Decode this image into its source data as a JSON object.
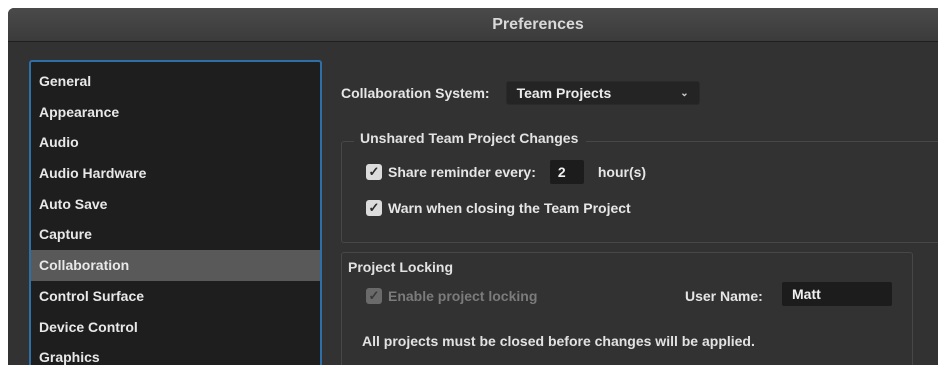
{
  "window": {
    "title": "Preferences"
  },
  "sidebar": {
    "items": [
      {
        "label": "General"
      },
      {
        "label": "Appearance"
      },
      {
        "label": "Audio"
      },
      {
        "label": "Audio Hardware"
      },
      {
        "label": "Auto Save"
      },
      {
        "label": "Capture"
      },
      {
        "label": "Collaboration",
        "selected": true
      },
      {
        "label": "Control Surface"
      },
      {
        "label": "Device Control"
      },
      {
        "label": "Graphics"
      }
    ]
  },
  "collaboration": {
    "system_label": "Collaboration System:",
    "system_value": "Team Projects",
    "unshared": {
      "title": "Unshared Team Project Changes",
      "share_label": "Share reminder every:",
      "share_checked": true,
      "share_value": "2",
      "share_unit": "hour(s)",
      "warn_label": "Warn when closing the Team Project",
      "warn_checked": true
    },
    "locking": {
      "title": "Project Locking",
      "enable_label": "Enable project locking",
      "enable_checked": true,
      "enable_disabled": true,
      "username_label": "User Name:",
      "username_value": "Matt",
      "note": "All projects must be closed before changes will be applied."
    }
  },
  "colors": {
    "panel_bg": "#323232",
    "list_bg": "#1e1e1e",
    "selected_bg": "#595959",
    "focus_border": "#2f6fa8"
  },
  "icons": {
    "check": "checkmark-icon",
    "dropdown": "chevron-down-icon"
  }
}
